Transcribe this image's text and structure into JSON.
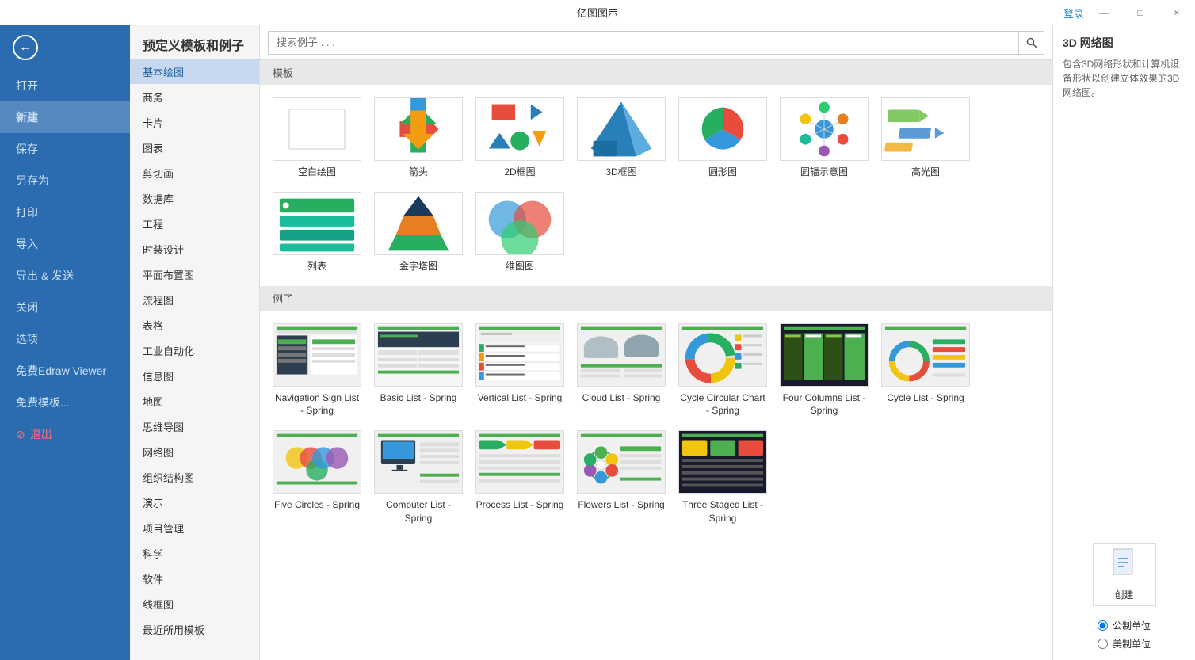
{
  "titlebar": {
    "title": "亿图图示",
    "login": "登录",
    "controls": [
      "—",
      "□",
      "×"
    ]
  },
  "sidebar": {
    "back_icon": "←",
    "items": [
      {
        "label": "打开",
        "id": "open"
      },
      {
        "label": "新建",
        "id": "new",
        "active": true
      },
      {
        "label": "保存",
        "id": "save"
      },
      {
        "label": "另存为",
        "id": "saveas"
      },
      {
        "label": "打印",
        "id": "print"
      },
      {
        "label": "导入",
        "id": "import"
      },
      {
        "label": "导出 & 发送",
        "id": "export"
      },
      {
        "label": "关闭",
        "id": "close"
      },
      {
        "label": "选项",
        "id": "options"
      },
      {
        "label": "免费Edraw Viewer",
        "id": "viewer"
      },
      {
        "label": "免费模板...",
        "id": "templates"
      },
      {
        "label": "退出",
        "id": "exit",
        "danger": true
      }
    ]
  },
  "page_title": "预定义模板和例子",
  "search": {
    "placeholder": "搜索例子 . . ."
  },
  "categories": [
    {
      "label": "基本绘图",
      "id": "basic",
      "active": true
    },
    {
      "label": "商务",
      "id": "business"
    },
    {
      "label": "卡片",
      "id": "card"
    },
    {
      "label": "图表",
      "id": "chart"
    },
    {
      "label": "剪切画",
      "id": "clipart"
    },
    {
      "label": "数据库",
      "id": "database"
    },
    {
      "label": "工程",
      "id": "engineering"
    },
    {
      "label": "时装设计",
      "id": "fashion"
    },
    {
      "label": "平面布置图",
      "id": "floorplan"
    },
    {
      "label": "流程图",
      "id": "flowchart"
    },
    {
      "label": "表格",
      "id": "table"
    },
    {
      "label": "工业自动化",
      "id": "industrial"
    },
    {
      "label": "信息图",
      "id": "infographic"
    },
    {
      "label": "地图",
      "id": "map"
    },
    {
      "label": "思维导图",
      "id": "mindmap"
    },
    {
      "label": "网络图",
      "id": "network"
    },
    {
      "label": "组织结构图",
      "id": "org"
    },
    {
      "label": "演示",
      "id": "presentation"
    },
    {
      "label": "项目管理",
      "id": "pm"
    },
    {
      "label": "科学",
      "id": "science"
    },
    {
      "label": "软件",
      "id": "software"
    },
    {
      "label": "线框图",
      "id": "wireframe"
    },
    {
      "label": "最近所用模板",
      "id": "recent"
    }
  ],
  "templates_section": "模板",
  "templates": [
    {
      "id": "blank",
      "label": "空白绘图",
      "type": "blank"
    },
    {
      "id": "arrow",
      "label": "箭头",
      "type": "arrow"
    },
    {
      "id": "2dframe",
      "label": "2D框图",
      "type": "2dframe"
    },
    {
      "id": "3dframe",
      "label": "3D框图",
      "type": "3dframe"
    },
    {
      "id": "circle",
      "label": "圆形图",
      "type": "circle"
    },
    {
      "id": "radial",
      "label": "圆辐示意图",
      "type": "radial"
    },
    {
      "id": "highlight",
      "label": "高光图",
      "type": "highlight"
    },
    {
      "id": "list",
      "label": "列表",
      "type": "list"
    },
    {
      "id": "pyramid",
      "label": "金字塔图",
      "type": "pyramid"
    },
    {
      "id": "venn",
      "label": "维图图",
      "type": "venn"
    }
  ],
  "examples_section": "例子",
  "examples": [
    {
      "id": "nav-sign-list",
      "label": "Navigation Sign List - Spring",
      "type": "navlist"
    },
    {
      "id": "basic-list",
      "label": "Basic List - Spring",
      "type": "basiclist"
    },
    {
      "id": "vertical-list",
      "label": "Vertical List - Spring",
      "type": "verticallist"
    },
    {
      "id": "cloud-list",
      "label": "Cloud List - Spring",
      "type": "cloudlist"
    },
    {
      "id": "cycle-circular",
      "label": "Cycle Circular Chart - Spring",
      "type": "cyclecircular"
    },
    {
      "id": "four-columns",
      "label": "Four Columns List - Spring",
      "type": "fourcolumns"
    },
    {
      "id": "cycle-list",
      "label": "Cycle List - Spring",
      "type": "cyclelist"
    },
    {
      "id": "five-circles",
      "label": "Five Circles - Spring",
      "type": "fivecircles"
    },
    {
      "id": "computer-list",
      "label": "Computer List - Spring",
      "type": "computerlist"
    },
    {
      "id": "process-list",
      "label": "Process List - Spring",
      "type": "processlist"
    },
    {
      "id": "flowers-list",
      "label": "Flowers List - Spring",
      "type": "flowerslist"
    },
    {
      "id": "three-staged",
      "label": "Three Staged List - Spring",
      "type": "threestaged"
    }
  ],
  "right_panel": {
    "title": "3D 网络图",
    "description": "包含3D网络形状和计算机设备形状以创建立体效果的3D网络图。",
    "create_label": "创建",
    "units": [
      {
        "label": "公制单位",
        "selected": true
      },
      {
        "label": "美制单位",
        "selected": false
      }
    ]
  }
}
